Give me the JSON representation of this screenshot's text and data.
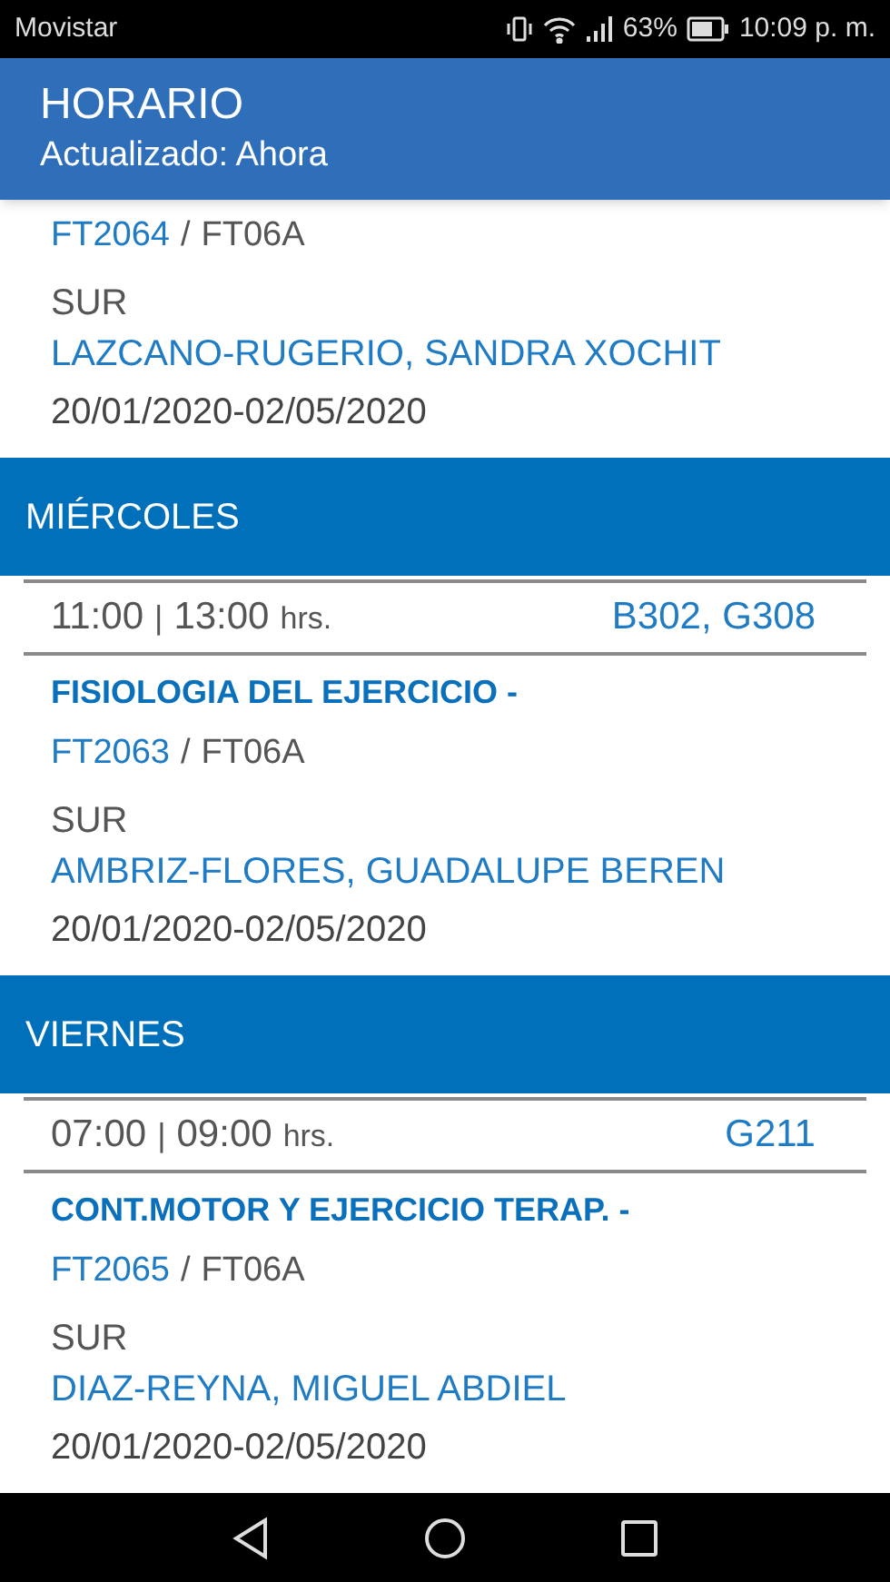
{
  "status_bar": {
    "carrier": "Movistar",
    "battery": "63%",
    "time": "10:09 p. m."
  },
  "header": {
    "title": "HORARIO",
    "subtitle": "Actualizado: Ahora"
  },
  "schedule": [
    {
      "kind": "class",
      "code": "FT2064",
      "separator": "/",
      "group": "FT06A",
      "campus": "SUR",
      "teacher": "LAZCANO-RUGERIO, SANDRA XOCHIT",
      "dates": "20/01/2020-02/05/2020"
    },
    {
      "kind": "day",
      "label": "MIÉRCOLES"
    },
    {
      "kind": "class",
      "start": "11:00",
      "divider": "|",
      "end": "13:00",
      "unit": "hrs.",
      "rooms": "B302, G308",
      "title": "FISIOLOGIA DEL EJERCICIO -",
      "code": "FT2063",
      "separator": "/",
      "group": "FT06A",
      "campus": "SUR",
      "teacher": "AMBRIZ-FLORES, GUADALUPE BEREN",
      "dates": "20/01/2020-02/05/2020"
    },
    {
      "kind": "day",
      "label": "VIERNES"
    },
    {
      "kind": "class",
      "start": "07:00",
      "divider": "|",
      "end": "09:00",
      "unit": "hrs.",
      "rooms": "G211",
      "title": "CONT.MOTOR Y EJERCICIO TERAP. -",
      "code": "FT2065",
      "separator": "/",
      "group": "FT06A",
      "campus": "SUR",
      "teacher": "DIAZ-REYNA, MIGUEL ABDIEL",
      "dates": "20/01/2020-02/05/2020"
    }
  ]
}
